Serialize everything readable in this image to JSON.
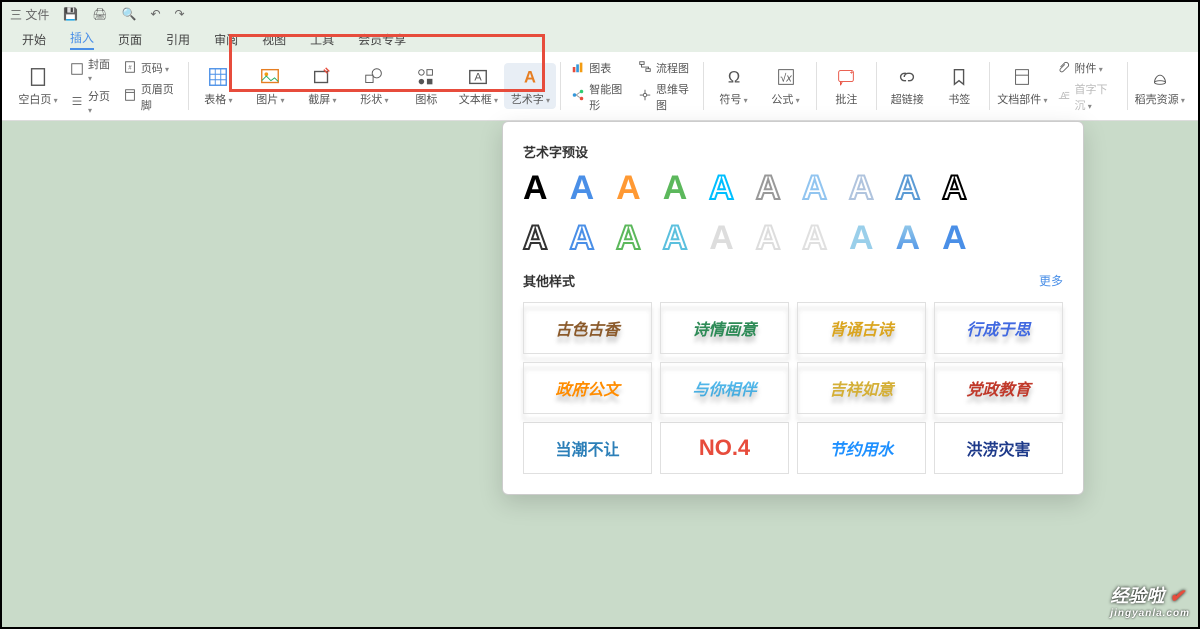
{
  "topbar": {
    "file": "三 文件",
    "undo": "↶",
    "redo": "↷"
  },
  "menu": {
    "items": [
      "开始",
      "插入",
      "页面",
      "引用",
      "审阅",
      "视图",
      "工具",
      "会员专享"
    ],
    "active": "插入"
  },
  "ribbon": {
    "col1": {
      "blank": "空白页",
      "cover": "封面",
      "pagenum": "页码",
      "section": "分页",
      "headerfooter": "页眉页脚"
    },
    "insert": {
      "table": "表格",
      "picture": "图片",
      "screenshot": "截屏",
      "shape": "形状",
      "icon": "图标",
      "textbox": "文本框",
      "wordart": "艺术字"
    },
    "smart": {
      "chart": "图表",
      "smartart": "智能图形",
      "flowchart": "流程图",
      "mindmap": "思维导图"
    },
    "symbol": {
      "symbol": "符号",
      "formula": "公式"
    },
    "comment": "批注",
    "hyperlink": "超链接",
    "bookmark": "书签",
    "docpart": "文档部件",
    "dropcap": "首字下沉",
    "attachment": "附件",
    "resource": "稻壳资源"
  },
  "popup": {
    "title1": "艺术字预设",
    "title2": "其他样式",
    "more": "更多",
    "presets_row1": [
      "#000000",
      "#4a8fe7",
      "#ff9933",
      "#5cb85c",
      "#00bfff",
      "#999999",
      "#92c5f0",
      "#b0c4de",
      "#5b9bd5",
      "#000000"
    ],
    "presets_row2": [
      "#333333",
      "#4a8fe7",
      "#5cb85c",
      "#5bc0de",
      "#cccccc",
      "#dddddd",
      "#e0e0e0",
      "#9acfea",
      "#7fb3d5",
      "#4a8fe7"
    ],
    "styles": [
      "古色古香",
      "诗情画意",
      "背诵古诗",
      "行成于思",
      "政府公文",
      "与你相伴",
      "吉祥如意",
      "党政教育",
      "当潮不让",
      "NO.4",
      "节约用水",
      "洪涝灾害"
    ]
  },
  "watermark": {
    "main": "经验啦",
    "check": "✔",
    "sub": "jingyanla.com"
  }
}
